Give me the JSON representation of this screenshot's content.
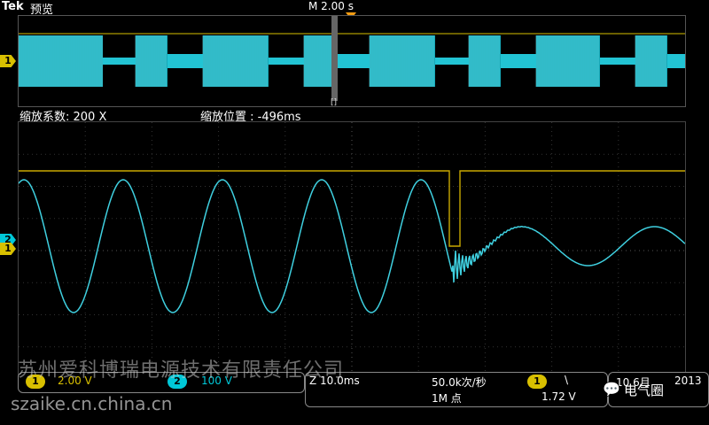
{
  "header": {
    "brand": "Tek",
    "mode": "预览",
    "horizontal_scale": "M 2.00 s"
  },
  "overview": {
    "cursor_mark": "[]"
  },
  "zoom": {
    "factor_label": "缩放系数: 200 X",
    "position_label": "缩放位置 : -496ms"
  },
  "channels": {
    "ch1": {
      "label": "1",
      "scale": "2.00 V",
      "color": "#d9c000"
    },
    "ch2": {
      "label": "2",
      "scale": "100 V",
      "color": "#00c8d8"
    }
  },
  "acquisition": {
    "zoom_timebase": "Z 10.0ms",
    "sample_rate": "50.0k次/秒",
    "record_length": "1M 点",
    "trigger_source": "1",
    "trigger_slope": "\\",
    "trigger_level": "1.72 V"
  },
  "datetime": {
    "date": "10 6月",
    "year": "2013"
  },
  "watermarks": {
    "company": "苏州爱科博瑞电源技术有限责任公司",
    "url": "szaike.cn.china.cn",
    "wechat": "电气圈"
  }
}
